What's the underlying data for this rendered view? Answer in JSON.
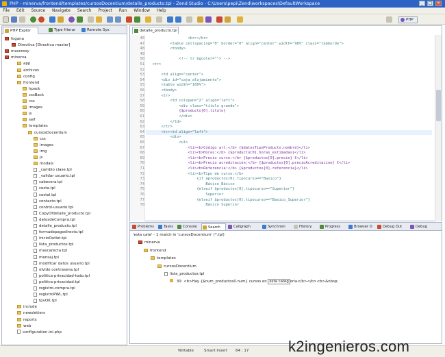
{
  "window": {
    "title": "PHP - minerva/frontend/templates/cursosDocentium/detalle_producto.tpl - Zend Studio - C:\\Users\\pepi\\Zend\\workspaces\\DefaultWorkspace",
    "minimize": "_",
    "maximize": "□",
    "close": "×"
  },
  "menu": [
    "File",
    "Edit",
    "Source",
    "Navigate",
    "Search",
    "Project",
    "Run",
    "Window",
    "Help"
  ],
  "perspective": "PHP",
  "explorer": {
    "tabs": [
      "PHP Explor",
      "Type Hierar",
      "Remote Sys"
    ],
    "tree": [
      {
        "label": "fogana",
        "type": "proj"
      },
      {
        "label": "Directiva [Directiva master]",
        "type": "proj"
      },
      {
        "label": "mascreoy",
        "type": "proj"
      },
      {
        "label": "minerva",
        "type": "proj"
      },
      {
        "label": "app",
        "type": "folder"
      },
      {
        "label": "archivos",
        "type": "folder"
      },
      {
        "label": "config",
        "type": "folder"
      },
      {
        "label": "frontend",
        "type": "folder"
      },
      {
        "label": "hpack",
        "type": "folder"
      },
      {
        "label": "cssBack",
        "type": "folder"
      },
      {
        "label": "css",
        "type": "folder"
      },
      {
        "label": "images",
        "type": "folder"
      },
      {
        "label": "js",
        "type": "folder"
      },
      {
        "label": "swf",
        "type": "folder"
      },
      {
        "label": "templates",
        "type": "folder"
      },
      {
        "label": "cursosDocentium",
        "type": "folder"
      },
      {
        "label": "css",
        "type": "folder"
      },
      {
        "label": "images",
        "type": "folder"
      },
      {
        "label": "img",
        "type": "folder"
      },
      {
        "label": "js",
        "type": "folder"
      },
      {
        "label": "modals",
        "type": "folder"
      },
      {
        "label": "_cambio clase.tpl",
        "type": "file"
      },
      {
        "label": "_validar usuario.tpl",
        "type": "file"
      },
      {
        "label": "cabecera.tpl",
        "type": "file"
      },
      {
        "label": "cesta.tpl",
        "type": "file"
      },
      {
        "label": "cestal.tpl",
        "type": "file"
      },
      {
        "label": "contacto.tpl",
        "type": "file"
      },
      {
        "label": "control-usuario.tpl",
        "type": "file"
      },
      {
        "label": "CopyOfdetalle_producto.tpl",
        "type": "file"
      },
      {
        "label": "datosdeCompra.tpl",
        "type": "file"
      },
      {
        "label": "detalle_producto.tpl",
        "type": "file"
      },
      {
        "label": "formadepagodirecto.tpl",
        "type": "file"
      },
      {
        "label": "inicioOutlet.tpl",
        "type": "file"
      },
      {
        "label": "lista_productos.tpl",
        "type": "file"
      },
      {
        "label": "mascarecta.tpl",
        "type": "file"
      },
      {
        "label": "mensaj.tpl",
        "type": "file"
      },
      {
        "label": "modificar datos usuario.tpl",
        "type": "file"
      },
      {
        "label": "olvido contrasena.tpl",
        "type": "file"
      },
      {
        "label": "politica-privacidad-todo.tpl",
        "type": "file"
      },
      {
        "label": "politica-privacidad.tpl",
        "type": "file"
      },
      {
        "label": "registro-compra.tpl",
        "type": "file"
      },
      {
        "label": "registroPWL.tpl",
        "type": "file"
      },
      {
        "label": "tpvOK.tpl",
        "type": "file"
      },
      {
        "label": "include",
        "type": "folder"
      },
      {
        "label": "newsletters",
        "type": "folder"
      },
      {
        "label": "reports",
        "type": "folder"
      },
      {
        "label": "web",
        "type": "folder"
      },
      {
        "label": "configuration.ini.php",
        "type": "file"
      }
    ]
  },
  "editor": {
    "tab": "detalle_producto.tpl",
    "lines": [
      {
        "n": "46",
        "t": "                  <br></br>"
      },
      {
        "n": "47",
        "t": "          <table cellspacing=\"0\" border=\"0\" align=\"center\" width=\"98%\" class=\"tabborde\">"
      },
      {
        "n": "48",
        "t": "          <tbody>"
      },
      {
        "n": "49",
        "t": ""
      },
      {
        "n": "50",
        "t": "              <!-- tr bgcolor=\"\"> -->"
      },
      {
        "n": "51",
        "t": "  <tr>"
      },
      {
        "n": "52",
        "t": ""
      },
      {
        "n": "53",
        "t": "      <td align=\"center\">"
      },
      {
        "n": "54",
        "t": "      <div id=\"caja_alojamiento\">"
      },
      {
        "n": "55",
        "t": "      <table width=\"100%\">"
      },
      {
        "n": "56",
        "t": "      <tbody>"
      },
      {
        "n": "57",
        "t": "      <tr>"
      },
      {
        "n": "58",
        "t": "          <td colspan=\"2\" align=\"left\">"
      },
      {
        "n": "59",
        "t": "              <div class=\"titulo grande\">"
      },
      {
        "n": "60",
        "t": "              {$producto[0].titulo}"
      },
      {
        "n": "61",
        "t": "              </div>"
      },
      {
        "n": "62",
        "t": "          </td>"
      },
      {
        "n": "63",
        "t": "      </tr>"
      },
      {
        "n": "64",
        "t": "      <tr><td align=\"left\">"
      },
      {
        "n": "65",
        "t": "          <div>"
      },
      {
        "n": "66",
        "t": "              <ul>"
      },
      {
        "n": "67",
        "t": "                  <li><b>Código art:</b> {$datosTipoProducto.nombre}</li>"
      },
      {
        "n": "68",
        "t": "                  <li><b>Horas:</b> {$producto[0].horas_estimadas}</li>"
      },
      {
        "n": "69",
        "t": "                  <li><b>Precio curso:</b> {$productos[0].precio} €</li>"
      },
      {
        "n": "70",
        "t": "                  <li><b>Precio acreditación:</b> {$productos[0].precioAcreditacion} €</li>"
      },
      {
        "n": "71",
        "t": "                  <li><b>Referencia:</b> {$productos[0].referencia}</li>"
      },
      {
        "n": "72",
        "t": "                  <li><b>Tipo de curso:</b>"
      },
      {
        "n": "73",
        "t": "                      {if $productos[0].tipocurso==\"Basico\"}"
      },
      {
        "n": "74",
        "t": "                          Básico_Básico"
      },
      {
        "n": "75",
        "t": "                      {elseif $productos[0].tipocurso==\"Superior\"}"
      },
      {
        "n": "76",
        "t": "                          Superior"
      },
      {
        "n": "77",
        "t": "                      {elseif $productos[0].tipocurso==\"Basico_Superior\"}"
      },
      {
        "n": "78",
        "t": "                          Básico Superior"
      }
    ]
  },
  "bottom": {
    "tabs": [
      "Problems",
      "Tasks",
      "Console",
      "Search",
      "Callgraph",
      "Synchroni",
      "History",
      "Progress",
      "Browser O",
      "Debug Out",
      "Debug"
    ],
    "summary": "'esta cate' - 1 match in 'cursosDocentium' (*.tpl)",
    "tree": [
      "minerva",
      "frontend",
      "templates",
      "cursosDocentium",
      "lista_productos.tpl"
    ],
    "match_line": "30:",
    "match_before": "<b>Hay {$num_productos0.num} cursos en ",
    "match_highlight": "esta categ",
    "match_after": "oria</b></b><b>&nbsp;"
  },
  "status": {
    "writable": "Writable",
    "insert": "Smart Insert",
    "position": "64 : 17"
  },
  "watermark": "k2ingenieros.com"
}
